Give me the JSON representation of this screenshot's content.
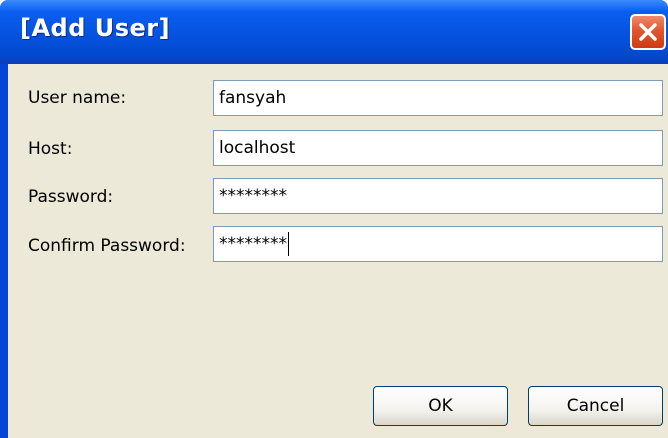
{
  "window": {
    "title": "[Add User]"
  },
  "form": {
    "user_name_label": "User name:",
    "user_name_value": "fansyah",
    "host_label": "Host:",
    "host_value": "localhost",
    "password_label": "Password:",
    "password_value": "********",
    "confirm_password_label": "Confirm Password:",
    "confirm_password_value": "********"
  },
  "buttons": {
    "ok_label": "OK",
    "cancel_label": "Cancel"
  },
  "icons": {
    "close": "close-icon"
  },
  "colors": {
    "titlebar": "#0654e2",
    "dialog_background": "#ece9d8",
    "close_button": "#e2562e",
    "field_border": "#7f9db9"
  }
}
